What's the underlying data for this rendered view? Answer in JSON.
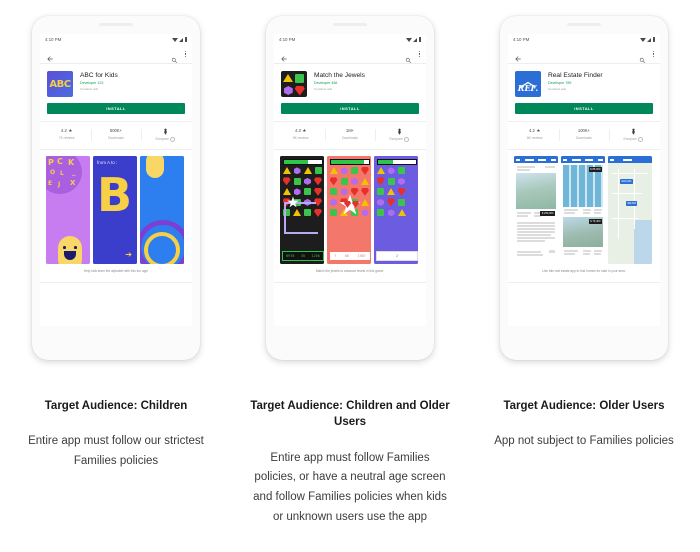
{
  "theme": {
    "install_green": "#00875a",
    "dev_green": "#0f9d58",
    "text_dark": "#212121",
    "text_muted": "#9e9e9e",
    "page_bg": "#ffffff"
  },
  "columns": [
    {
      "id": "children",
      "phone": {
        "status": {
          "time": "4:10 PM",
          "wifi": "wifi-icon",
          "signal": "signal-icon",
          "battery": "battery-icon"
        },
        "appbar": {
          "back": "back-arrow-icon",
          "search": "search-icon",
          "more": "overflow-menu-icon"
        },
        "app": {
          "icon_name": "abc-app-icon",
          "icon_text": "ABC",
          "title": "ABC for Kids",
          "developer": "Developer 123",
          "ads": "Contains ads"
        },
        "install_label": "INSTALL",
        "stats": [
          {
            "value": "4.2",
            "icon": "star-icon",
            "label": "7K reviews"
          },
          {
            "value": "500K+",
            "icon": "",
            "label": "Downloads"
          },
          {
            "value": "",
            "icon": "content-rating-icon",
            "label": "Everyone"
          }
        ],
        "shots_caption": "Help kids learn the alphabet with this fun app!",
        "shot_text": {
          "from_a_to": "from A  to :",
          "big_letter": "B",
          "letters": [
            "P",
            "C",
            "K",
            "O",
            "L",
            "A",
            "E",
            "J",
            "X",
            "—"
          ]
        }
      },
      "caption_title": "Target Audience: Children",
      "caption_body": "Entire app must follow our strictest Families policies"
    },
    {
      "id": "children-and-older",
      "phone": {
        "status": {
          "time": "4:10 PM",
          "wifi": "wifi-icon",
          "signal": "signal-icon",
          "battery": "battery-icon"
        },
        "appbar": {
          "back": "back-arrow-icon",
          "search": "search-icon",
          "more": "overflow-menu-icon"
        },
        "app": {
          "icon_name": "jewels-app-icon",
          "icon_text": "",
          "title": "Match the Jewels",
          "developer": "Developer 456",
          "ads": "Contains ads"
        },
        "install_label": "INSTALL",
        "stats": [
          {
            "value": "4.3",
            "icon": "star-icon",
            "label": "9K reviews"
          },
          {
            "value": "1M+",
            "icon": "",
            "label": "Downloads"
          },
          {
            "value": "",
            "icon": "content-rating-icon",
            "label": "Everyone"
          }
        ],
        "shots_caption": "Match the jewels to advance levels in this game.",
        "shot_text": {
          "score_1": "6978",
          "moves_1": "35",
          "points_1": "1256",
          "score_2": "?",
          "moves_2": "66",
          "points_2": "1987",
          "points_3": "2"
        }
      },
      "caption_title": "Target Audience: Children and Older Users",
      "caption_body": "Entire app must follow Families policies, or have a neutral age screen and follow Families policies when kids or unknown users use the app"
    },
    {
      "id": "older-users",
      "phone": {
        "status": {
          "time": "4:10 PM",
          "wifi": "wifi-icon",
          "signal": "signal-icon",
          "battery": "battery-icon"
        },
        "appbar": {
          "back": "back-arrow-icon",
          "search": "search-icon",
          "more": "overflow-menu-icon"
        },
        "app": {
          "icon_name": "real-estate-app-icon",
          "icon_text": "REF.",
          "title": "Real Estate Finder",
          "developer": "Developer 789",
          "ads": "Contains ads"
        },
        "install_label": "INSTALL",
        "stats": [
          {
            "value": "4.2",
            "icon": "star-icon",
            "label": "8K reviews"
          },
          {
            "value": "100K+",
            "icon": "",
            "label": "Downloads"
          },
          {
            "value": "",
            "icon": "content-rating-icon",
            "label": "Everyone"
          }
        ],
        "shots_caption": "Use this real estate app to find homes for sale in your area.",
        "shot_text": {
          "price_1": "$ 250,000",
          "price_2": "$ 85,000",
          "price_3": "$ 76,400",
          "map_pin_1": "$120,000",
          "map_pin_2": "$99,500"
        }
      },
      "caption_title": "Target Audience: Older Users",
      "caption_body": "App not subject to Families policies"
    }
  ]
}
